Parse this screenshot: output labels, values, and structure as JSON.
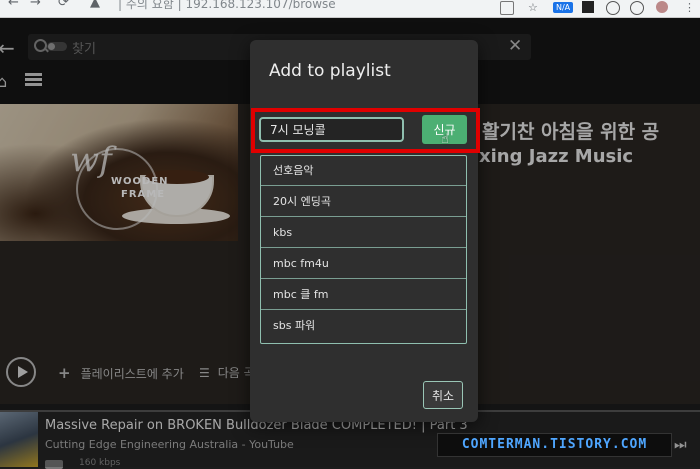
{
  "browser": {
    "back": "←",
    "forward": "→",
    "url": "| 주의 요함 | 192.168.123.107/browse",
    "ext_badge": "N/A"
  },
  "app": {
    "search_placeholder": "찾기",
    "clear": "✕",
    "back_icon": "←",
    "home_icon": "⌂",
    "hero": {
      "logo_letters": "wf",
      "logo_line1": "WOODEN",
      "logo_line2": "FRAME",
      "title": "활기찬 아침을 위한 공",
      "subtitle": "xing Jazz Music"
    },
    "actions": {
      "add_to_playlist": "플레이리스트에 추가",
      "next": "다음 곡"
    },
    "now_playing": {
      "title": "Massive Repair on BROKEN Bulldozer Blade COMPLETED! | Part 3",
      "artist": "Cutting Edge Engineering Australia - YouTube",
      "bitrate": "160 kbps"
    },
    "watermark": "COMTERMAN.TISTORY.COM"
  },
  "modal": {
    "title": "Add to playlist",
    "input_value": "7시 모닝콜",
    "new_button": "신규",
    "playlists": [
      "선호음악",
      "20시 엔딩곡",
      "kbs",
      "mbc fm4u",
      "mbc 클 fm",
      "sbs 파워"
    ],
    "cancel_button": "취소"
  },
  "colors": {
    "accent_green": "#4caf73",
    "highlight_red": "#e00000",
    "list_border": "#8fbfaf"
  }
}
